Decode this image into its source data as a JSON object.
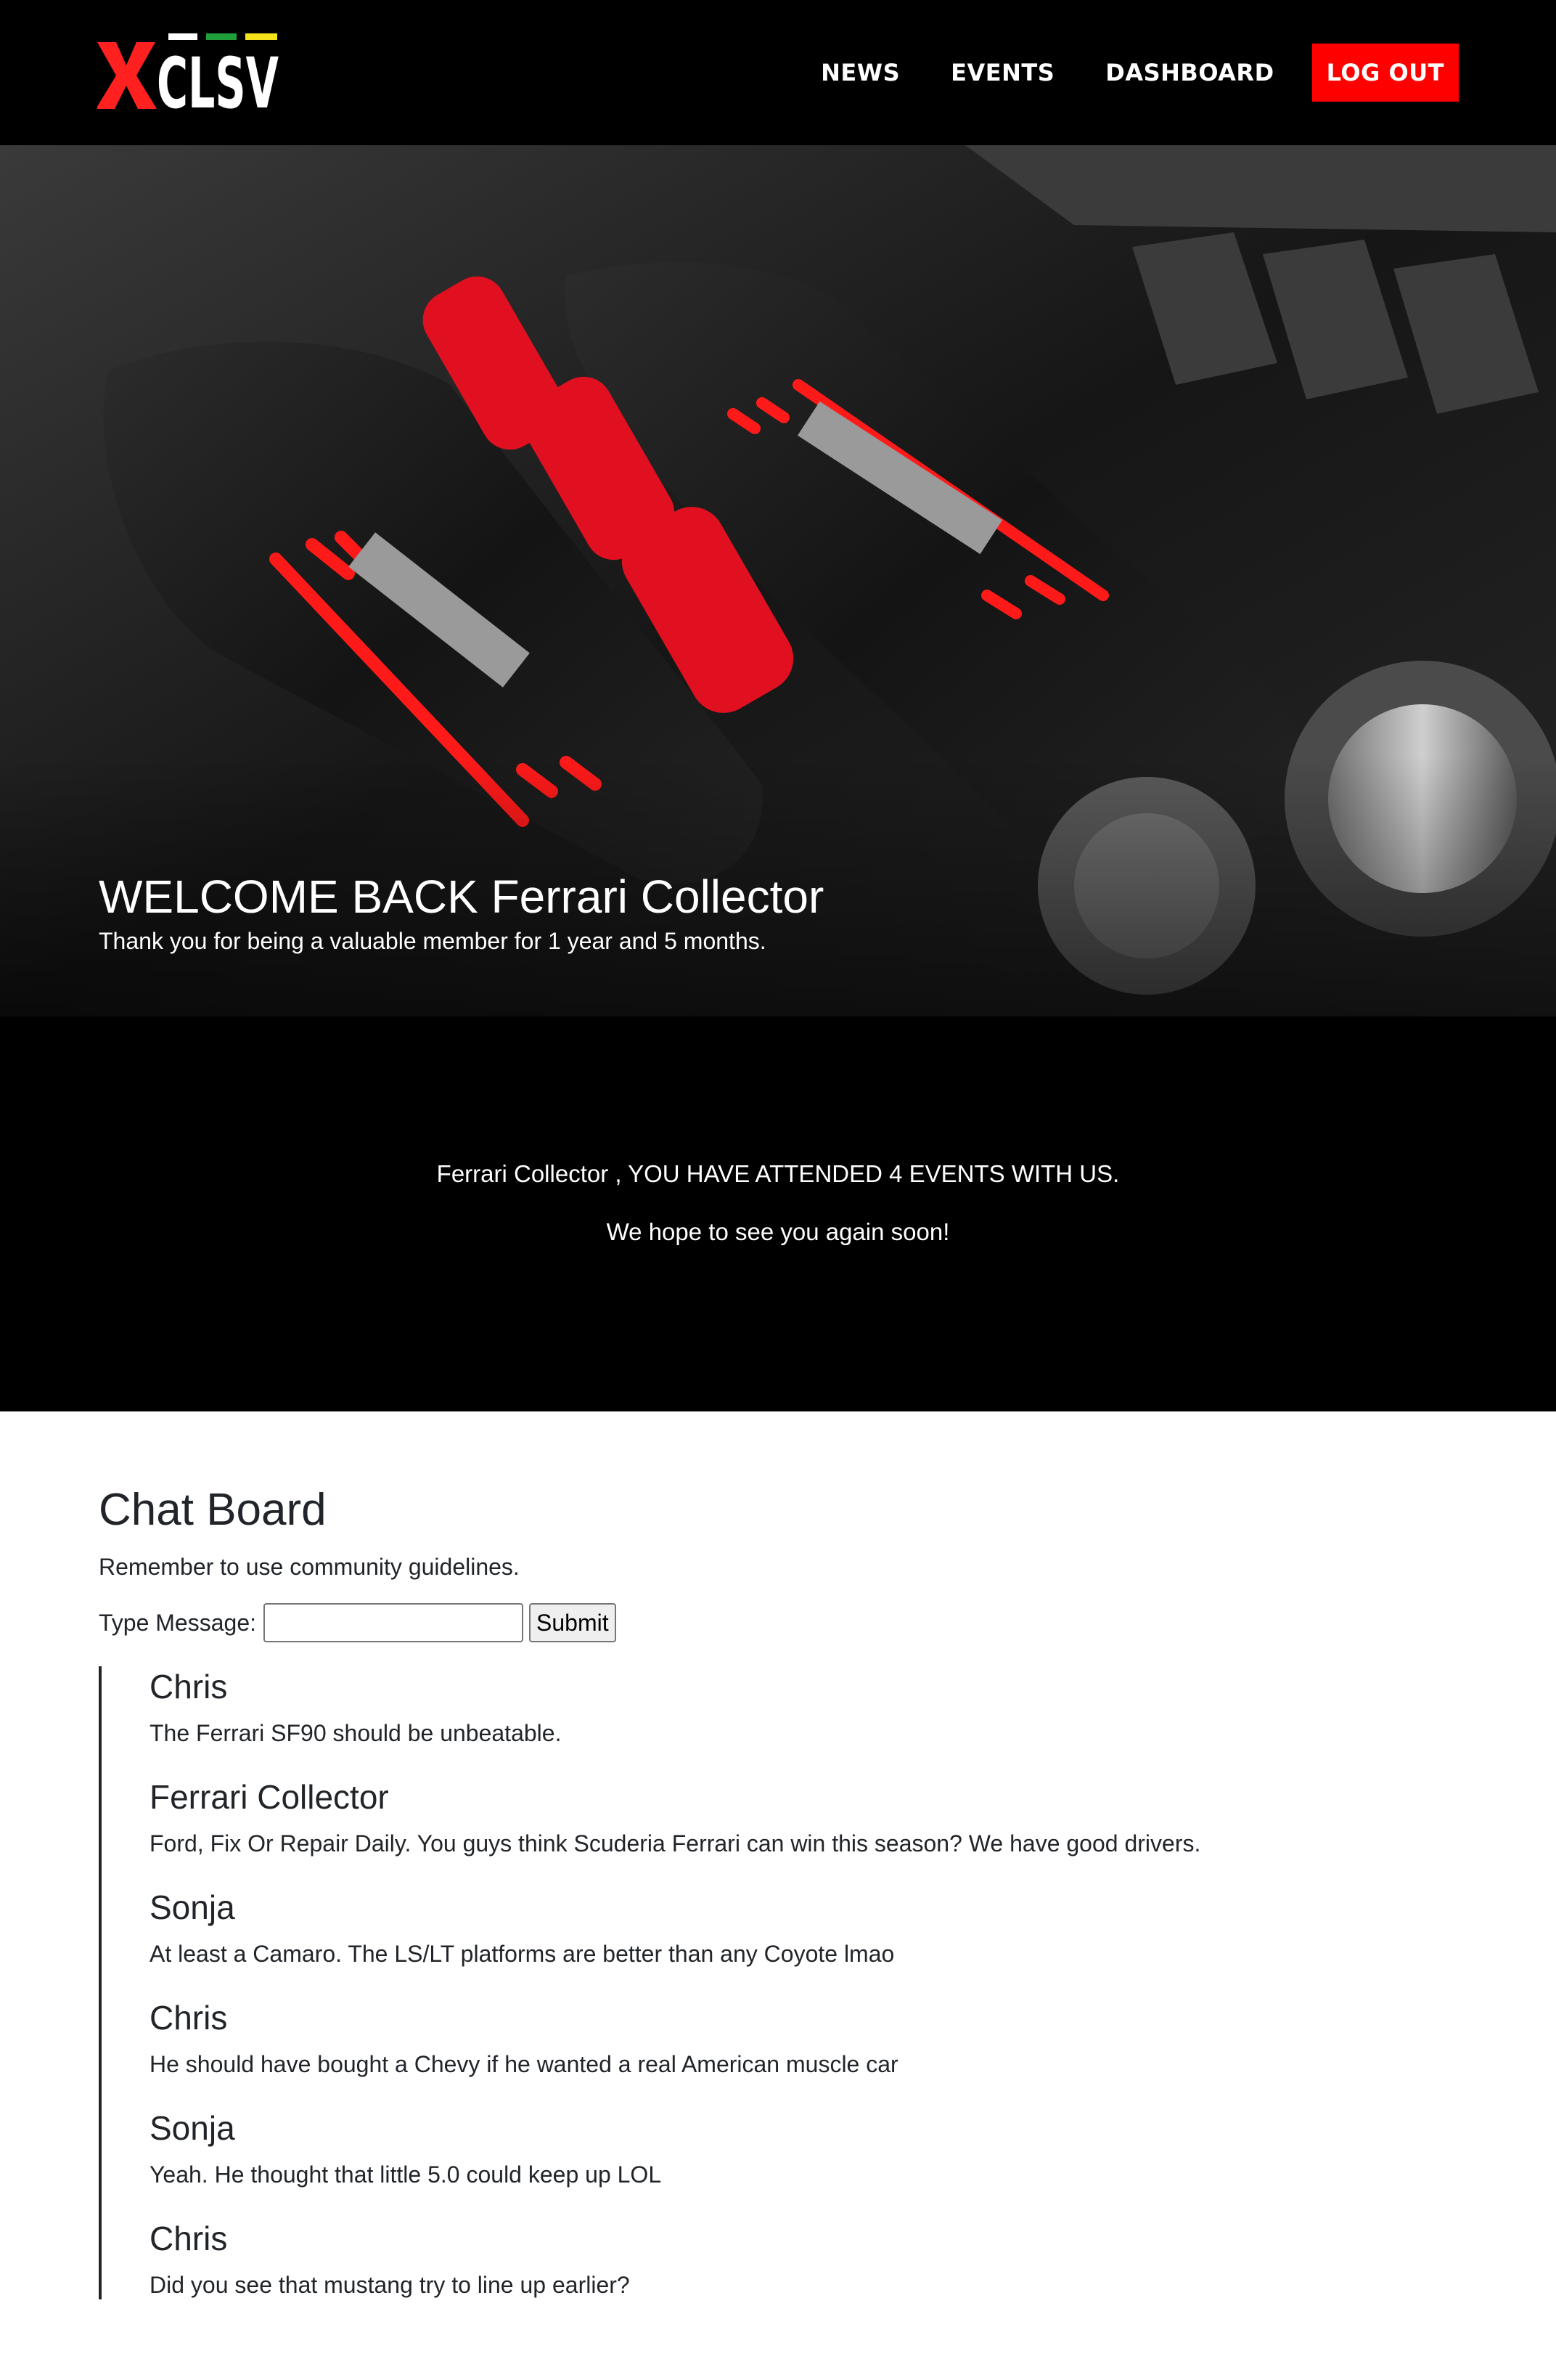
{
  "header": {
    "logo": {
      "text": "XCLSV",
      "stripe_colors": [
        "#ffffff",
        "#1f9e3a",
        "#f6e21b"
      ],
      "accent": "#ff2020"
    },
    "nav": {
      "news": "NEWS",
      "events": "EVENTS",
      "dashboard": "DASHBOARD",
      "logout": "LOG OUT"
    }
  },
  "hero": {
    "title": "WELCOME BACK Ferrari Collector",
    "subtitle": "Thank you for being a valuable member for 1 year and 5 months."
  },
  "stats": {
    "line1": "Ferrari Collector , YOU HAVE ATTENDED 4 EVENTS WITH US.",
    "line2": "We hope to see you again soon!"
  },
  "chat": {
    "title": "Chat Board",
    "guidelines": "Remember to use community guidelines.",
    "input_label": "Type Message:",
    "input_value": "",
    "submit_label": "Submit",
    "messages": [
      {
        "user": "Chris",
        "text": "The Ferrari SF90 should be unbeatable."
      },
      {
        "user": "Ferrari Collector",
        "text": "Ford, Fix Or Repair Daily. You guys think Scuderia Ferrari can win this season? We have good drivers."
      },
      {
        "user": "Sonja",
        "text": "At least a Camaro. The LS/LT platforms are better than any Coyote lmao"
      },
      {
        "user": "Chris",
        "text": "He should have bought a Chevy if he wanted a real American muscle car"
      },
      {
        "user": "Sonja",
        "text": "Yeah. He thought that little 5.0 could keep up LOL"
      },
      {
        "user": "Chris",
        "text": "Did you see that mustang try to line up earlier?"
      }
    ]
  },
  "colors": {
    "header_bg": "#000000",
    "logout_bg": "#ff0000",
    "accent_red": "#ff0000"
  }
}
